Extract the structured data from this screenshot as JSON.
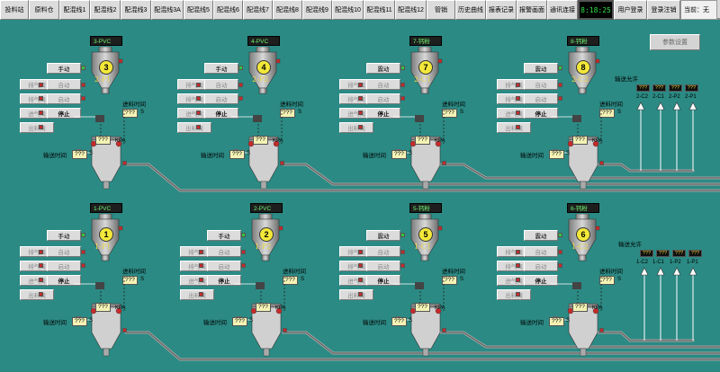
{
  "nav": {
    "items": [
      "投料站",
      "原料仓",
      "配混线1",
      "配混线2",
      "配混线3",
      "配混线3A",
      "配混线5",
      "配混线6",
      "配混线7",
      "配混线8",
      "配混线9",
      "配混线10",
      "配混线11",
      "配混线12",
      "管销",
      "历史曲线",
      "报表记录",
      "报警画面",
      "通讯连接"
    ],
    "clock": "8:18:25",
    "user_login": "用户登录",
    "logout": "登录注销",
    "current": "当前：无"
  },
  "param_button": "参数设置",
  "common": {
    "manual": "手动",
    "auto": "自动",
    "start": "启动",
    "stop": "停止",
    "exhaust": "排气阀",
    "feed": "进气阀",
    "discharge": "出料阀",
    "clean": "震动",
    "feed_time": "进料时间",
    "convey_time": "输送时间",
    "s": "S",
    "kpa": "KPA",
    "qqq": "???",
    "permit": "输送允许"
  },
  "units": [
    {
      "num": "3",
      "tag": "3-PVC",
      "code": "2-P1",
      "top": "手动",
      "second": "排气阀"
    },
    {
      "num": "4",
      "tag": "4-PVC",
      "code": "2-P2",
      "top": "手动",
      "second": "排气阀"
    },
    {
      "num": "7",
      "tag": "7-钙粉",
      "code": "2-C1",
      "top": "震动",
      "second": "排气阀"
    },
    {
      "num": "8",
      "tag": "8-钙粉",
      "code": "2-C2",
      "top": "震动",
      "second": "排气阀"
    },
    {
      "num": "1",
      "tag": "1-PVC",
      "code": "1-P1",
      "top": "手动",
      "second": "排气阀"
    },
    {
      "num": "2",
      "tag": "2-PVC",
      "code": "1-P2",
      "top": "手动",
      "second": "排气阀"
    },
    {
      "num": "5",
      "tag": "5-钙粉",
      "code": "1-C1",
      "top": "震动",
      "second": "排气阀"
    },
    {
      "num": "6",
      "tag": "6-钙粉",
      "code": "1-C2",
      "top": "震动",
      "second": "排气阀"
    }
  ],
  "permits": [
    {
      "labels": [
        "2-C2",
        "2-C1",
        "2-P2",
        "2-P1"
      ]
    },
    {
      "labels": [
        "1-C2",
        "1-C1",
        "1-P2",
        "1-P1"
      ]
    }
  ],
  "colors": {
    "background": "#2b8a84",
    "pipe": "#b0b0b0",
    "value_box": "#f4f3b5",
    "hopper_number": "#f3e83a",
    "led_green": "#31c740",
    "led_red": "#c62a2a"
  }
}
